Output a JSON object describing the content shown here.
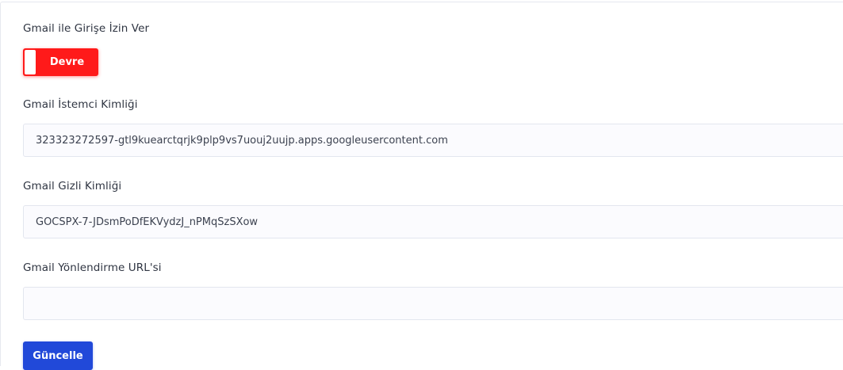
{
  "settings": {
    "allow_login_label": "Gmail ile Girişe İzin Ver",
    "toggle": {
      "state_label": "Devre",
      "enabled": false,
      "color": "#ff1a1a"
    },
    "client_id": {
      "label": "Gmail İstemci Kimliği",
      "value": "323323272597-gtl9kuearctqrjk9plp9vs7uouj2uujp.apps.googleusercontent.com"
    },
    "client_secret": {
      "label": "Gmail Gizli Kimliği",
      "value": "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"
    },
    "redirect_url": {
      "label": "Gmail Yönlendirme URL'si",
      "value": ""
    },
    "update_button": {
      "label": "Güncelle",
      "color": "#2149d9"
    }
  }
}
